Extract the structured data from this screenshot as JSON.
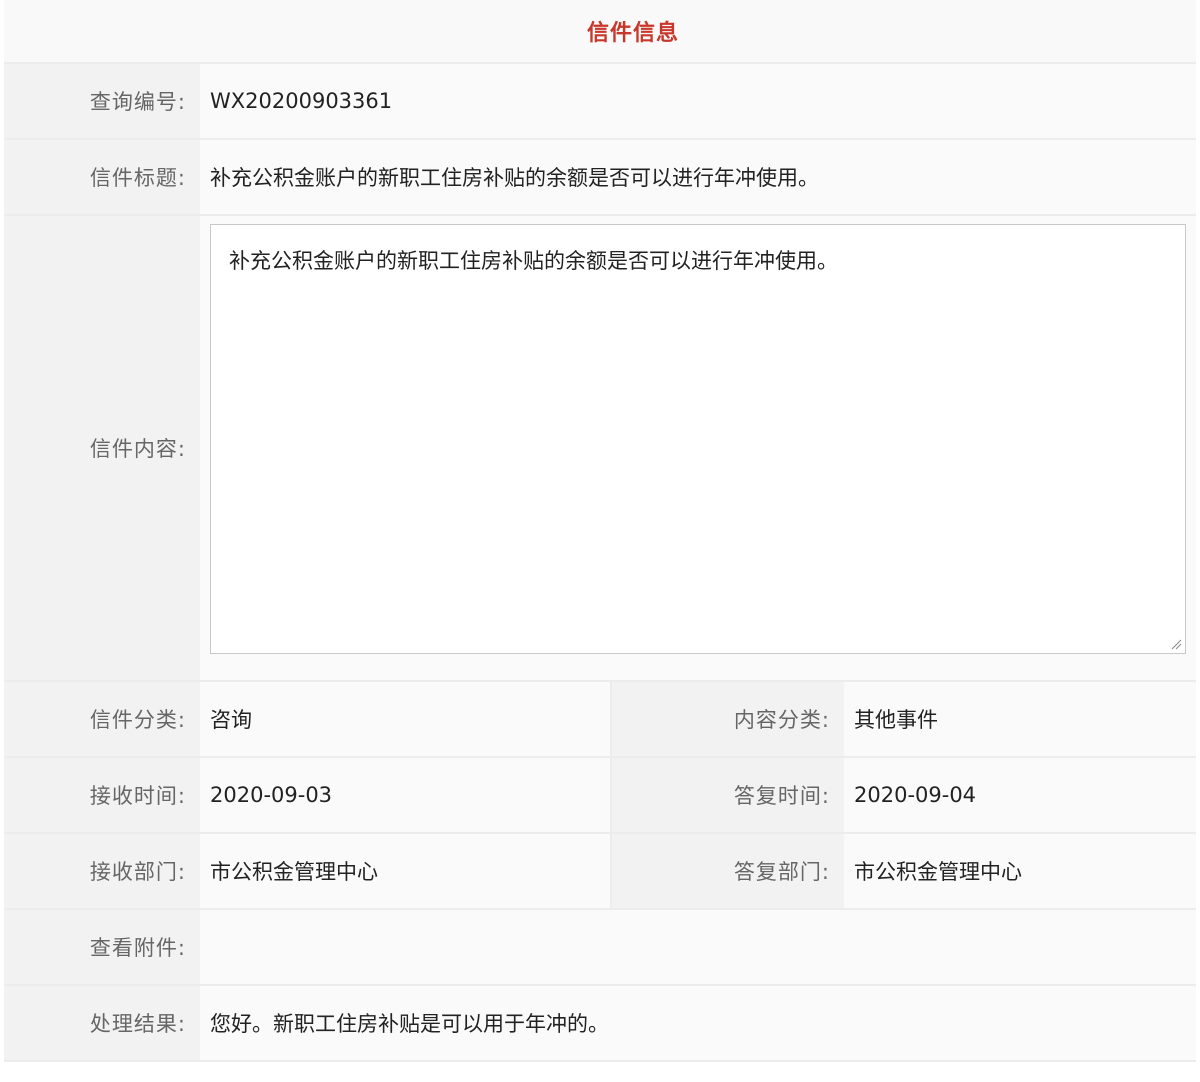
{
  "header": {
    "title": "信件信息"
  },
  "fields": {
    "query_no": {
      "label": "查询编号:",
      "value": "WX20200903361"
    },
    "title": {
      "label": "信件标题:",
      "value": "补充公积金账户的新职工住房补贴的余额是否可以进行年冲使用。"
    },
    "content": {
      "label": "信件内容:",
      "value": "补充公积金账户的新职工住房补贴的余额是否可以进行年冲使用。"
    },
    "letter_category": {
      "label": "信件分类:",
      "value": "咨询"
    },
    "content_category": {
      "label": "内容分类:",
      "value": "其他事件"
    },
    "receive_time": {
      "label": "接收时间:",
      "value": "2020-09-03"
    },
    "reply_time": {
      "label": "答复时间:",
      "value": "2020-09-04"
    },
    "receive_dept": {
      "label": "接收部门:",
      "value": "市公积金管理中心"
    },
    "reply_dept": {
      "label": "答复部门:",
      "value": "市公积金管理中心"
    },
    "attachments": {
      "label": "查看附件:",
      "value": ""
    },
    "result": {
      "label": "处理结果:",
      "value": "您好。新职工住房补贴是可以用于年冲的。"
    }
  },
  "colors": {
    "accent": "#c8372b",
    "label_bg": "#f2f2f2",
    "value_bg": "#fafafa",
    "border": "#ececec"
  },
  "icons": {
    "resize": "resize-grip-icon"
  }
}
